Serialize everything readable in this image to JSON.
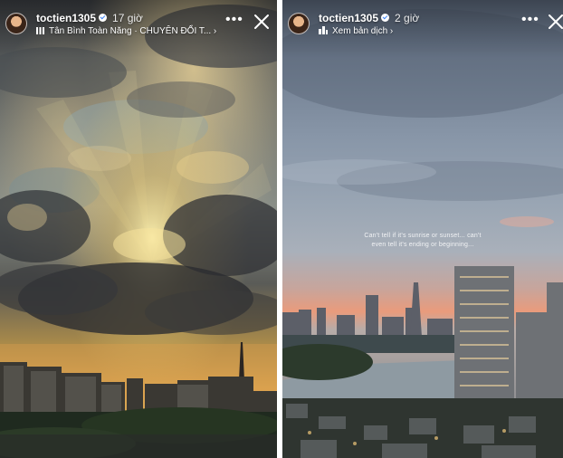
{
  "stories": [
    {
      "username": "toctien1305",
      "time": "17 giờ",
      "subtitle": "Tân Bình Toàn Năng · CHUYÊN ĐỔI T... ›",
      "more_icon": "more-horizontal-icon",
      "close_icon": "close-icon"
    },
    {
      "username": "toctien1305",
      "time": "2 giờ",
      "subtitle": "Xem bản dịch ›",
      "caption_line1": "Can't tell if it's sunrise or sunset... can't",
      "caption_line2": "even tell it's ending or beginning...",
      "more_icon": "more-horizontal-icon",
      "close_icon": "close-icon"
    }
  ]
}
